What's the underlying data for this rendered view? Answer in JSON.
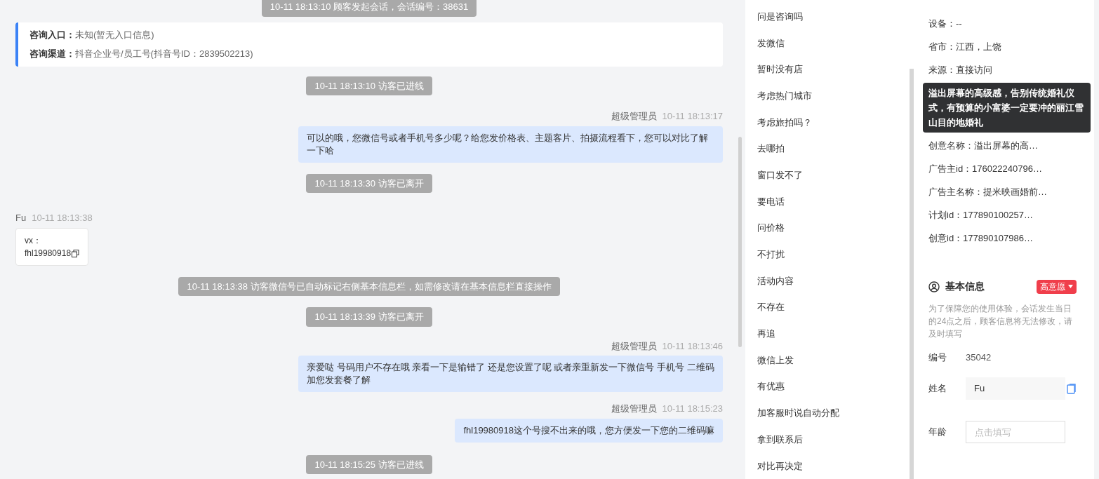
{
  "chat": {
    "messages": [
      {
        "kind": "system",
        "text": "10-11 18:13:10 顾客发起会话，会话编号：38631"
      },
      {
        "kind": "source",
        "rows": [
          {
            "label": "咨询入口：",
            "value": "未知(暂无入口信息)"
          },
          {
            "label": "咨询渠道：",
            "value": "抖音企业号/员工号(抖音号ID：2839502213)"
          }
        ]
      },
      {
        "kind": "system",
        "text": "10-11 18:13:10 访客已进线"
      },
      {
        "kind": "agent",
        "sender": "超级管理员",
        "time": "10-11 18:13:17",
        "text": "可以的哦，您微信号或者手机号多少呢？给您发价格表、主题客片、拍摄流程看下，您可以对比了解一下哈"
      },
      {
        "kind": "system",
        "text": "10-11 18:13:30 访客已离开"
      },
      {
        "kind": "visitor",
        "sender": "Fu",
        "time": "10-11 18:13:38",
        "lines": [
          "vx：",
          "fhl19980918"
        ]
      },
      {
        "kind": "system",
        "text": "10-11 18:13:38 访客微信号已自动标记右侧基本信息栏，如需修改请在基本信息栏直接操作"
      },
      {
        "kind": "system",
        "text": "10-11 18:13:39 访客已离开"
      },
      {
        "kind": "agent",
        "sender": "超级管理员",
        "time": "10-11 18:13:46",
        "text": "亲爱哒 号码用户不存在哦 亲看一下是输错了 还是您设置了呢 或者亲重新发一下微信号 手机号 二维码加您发套餐了解"
      },
      {
        "kind": "agent",
        "sender": "超级管理员",
        "time": "10-11 18:15:23",
        "text": "fhl19980918这个号搜不出来的哦，您方便发一下您的二维码嘛"
      },
      {
        "kind": "system",
        "text": "10-11 18:15:25 访客已进线"
      }
    ]
  },
  "quick_replies": [
    "问是咨询吗",
    "发微信",
    "暂时没有店",
    "考虑热门城市",
    "考虑旅拍吗？",
    "去哪拍",
    "窗口发不了",
    "要电话",
    "问价格",
    "不打扰",
    "活动内容",
    "不存在",
    "再追",
    "微信上发",
    "有优惠",
    "加客服时说自动分配",
    "拿到联系后",
    "对比再决定"
  ],
  "visitor_info": {
    "rows": [
      {
        "kind": "row",
        "text": "设备：--"
      },
      {
        "kind": "row",
        "text": "省市：江西，上饶"
      },
      {
        "kind": "row",
        "text": "来源：直接访问"
      },
      {
        "kind": "tooltip",
        "text": "溢出屏幕的高级感，告别传统婚礼仪式，有预算的小富婆一定要冲的丽江雪山目的地婚礼"
      },
      {
        "kind": "row",
        "text": "创意名称：溢出屏幕的高…"
      },
      {
        "kind": "row",
        "text": "广告主id：176022240796…"
      },
      {
        "kind": "row",
        "text": "广告主名称：提米映画婚前…"
      },
      {
        "kind": "row",
        "text": "计划id：177890100257…"
      },
      {
        "kind": "row",
        "text": "创意id：177890107986…"
      }
    ]
  },
  "basic_info": {
    "title": "基本信息",
    "intent_tag": "高意愿",
    "notice": "为了保障您的使用体验，会话发生当日的24点之后，顾客信息将无法修改，请及时填写",
    "fields": [
      {
        "kind": "static",
        "label": "编号",
        "value": "35042"
      },
      {
        "kind": "filled",
        "label": "姓名",
        "value": "Fu"
      },
      {
        "kind": "input",
        "label": "年龄",
        "placeholder": "点击填写"
      }
    ]
  }
}
